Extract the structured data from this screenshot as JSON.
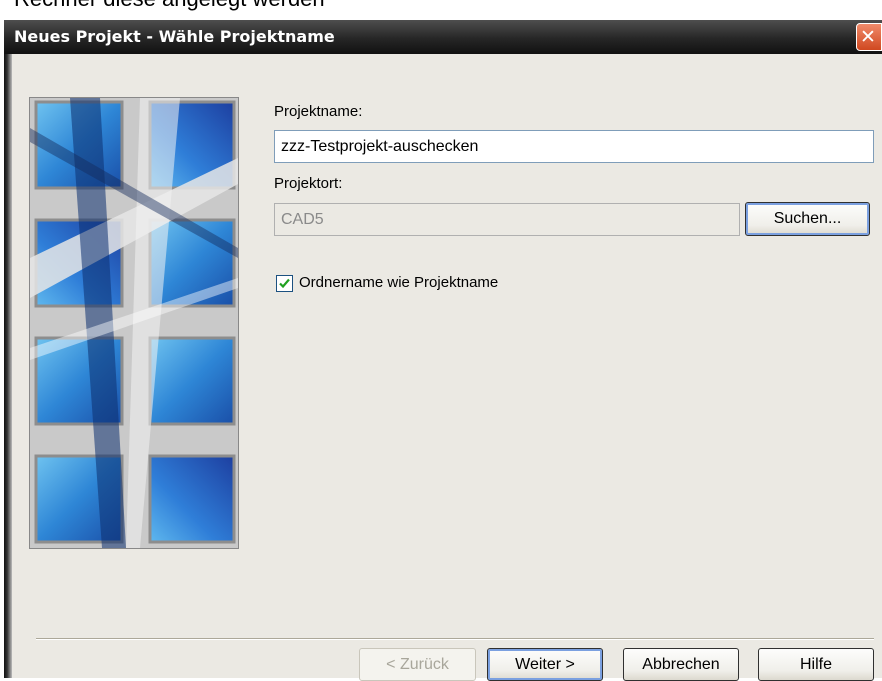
{
  "top_text": "Rechner diese angelegt werden",
  "window": {
    "title": "Neues Projekt - Wähle Projektname",
    "close_glyph": "✕"
  },
  "form": {
    "projektname_label": "Projektname:",
    "projektname_value": "zzz-Testprojekt-auschecken",
    "projektort_label": "Projektort:",
    "projektort_value": "CAD5",
    "suchen_label": "Suchen...",
    "checkbox_label": "Ordnername wie Projektname",
    "checkbox_checked": true
  },
  "buttons": {
    "zurueck_label": "< Zurück",
    "weiter_label": "Weiter >",
    "abbrechen_label": "Abbrechen",
    "hilfe_label": "Hilfe"
  },
  "colors": {
    "titlebar": "#262626",
    "close_button": "#e0603a",
    "content_bg": "#ebe9e3",
    "image_blue": "#2f7ed8"
  },
  "icons": [
    "close-icon",
    "checkmark-icon"
  ]
}
